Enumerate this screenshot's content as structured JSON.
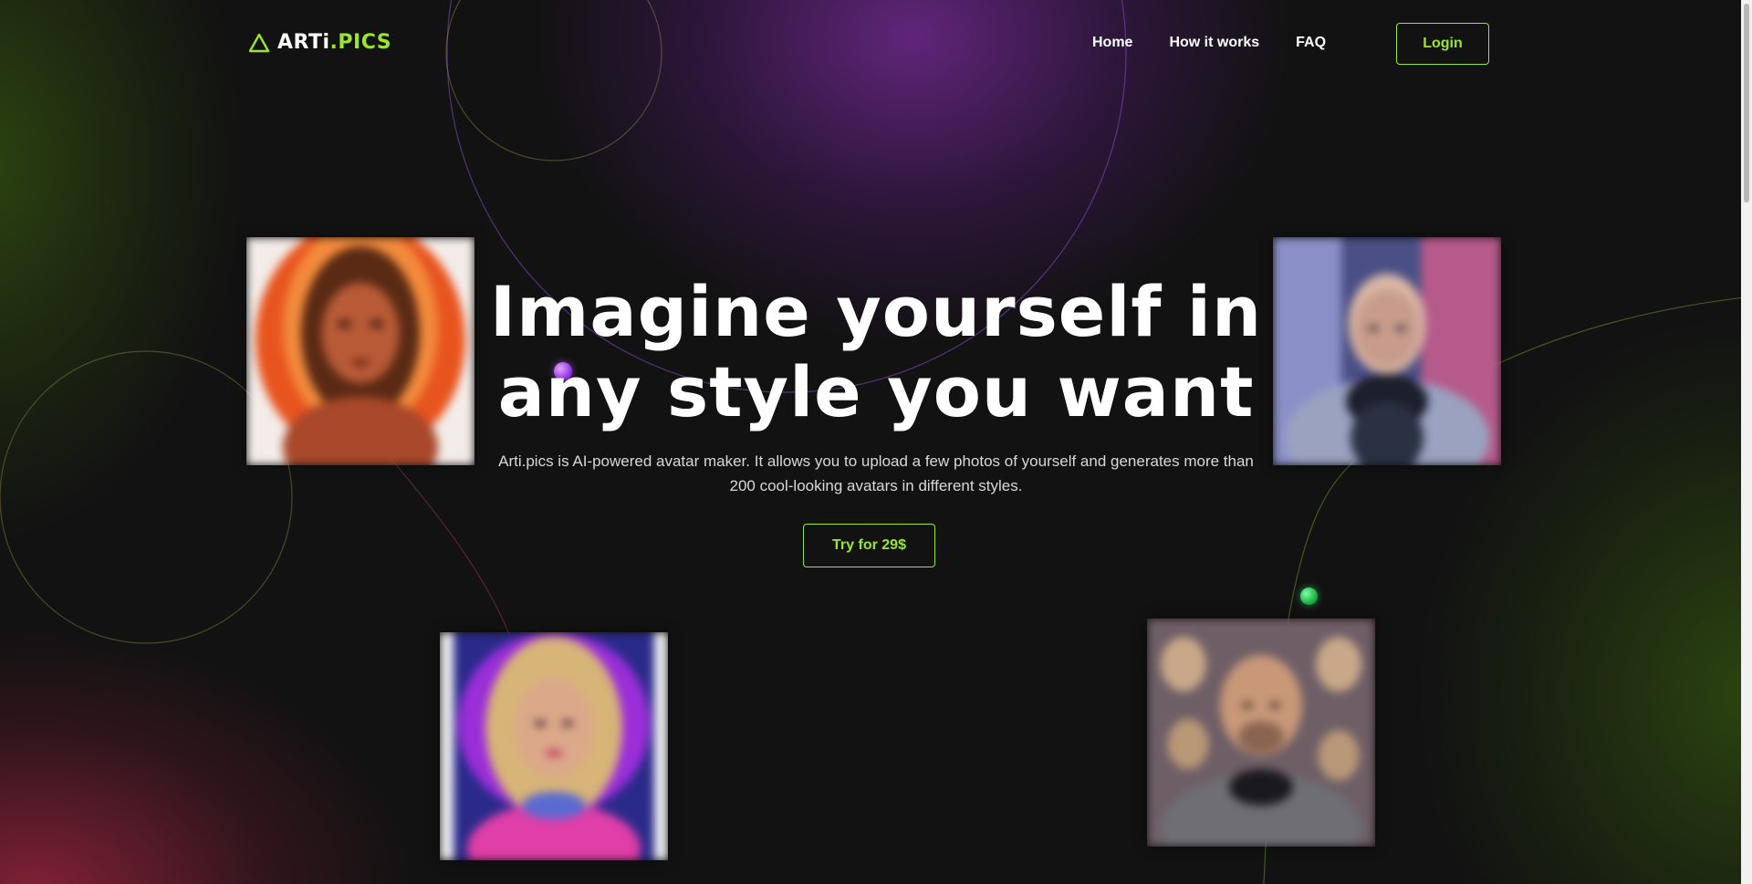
{
  "header": {
    "logo": {
      "prefix": "ARTi",
      "suffix": ".PICS",
      "icon": "triangle-logo-icon"
    },
    "nav": [
      "Home",
      "How it works",
      "FAQ"
    ],
    "login_label": "Login"
  },
  "hero": {
    "title_line1": "Imagine yourself in",
    "title_line2": "any style you want",
    "description": "Arti.pics is AI-powered avatar maker. It allows you to upload a few photos of yourself and generates more than 200 cool-looking avatars in different styles.",
    "cta_label": "Try for 29$"
  },
  "avatars": [
    {
      "name": "fire-woman-avatar"
    },
    {
      "name": "astronaut-man-avatar"
    },
    {
      "name": "neon-woman-avatar"
    },
    {
      "name": "bald-man-avatar"
    }
  ],
  "colors": {
    "accent": "#9be52a",
    "background": "#121212",
    "text": "#ffffff",
    "purple_glow": "#6e288c",
    "green_glow": "#2d460f",
    "red_glow": "#96233c"
  }
}
